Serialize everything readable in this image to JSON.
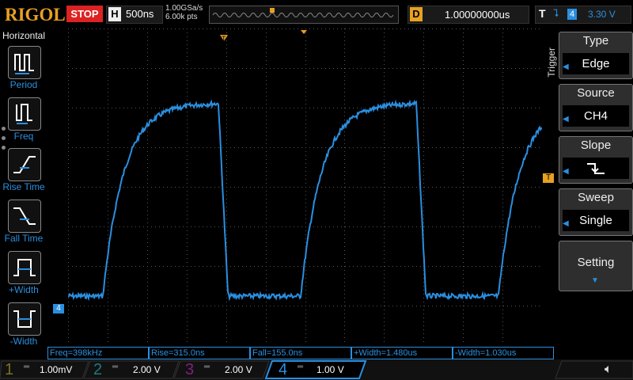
{
  "header": {
    "logo": "RIGOL",
    "run_state": "STOP",
    "horizontal_letter": "H",
    "timebase": "500ns",
    "sample_rate": "1.00GSa/s",
    "memory_depth": "6.00k pts",
    "delay_letter": "D",
    "delay": "1.00000000us",
    "trigger_letter": "T",
    "trigger_source": "4",
    "trigger_level": "3.30 V"
  },
  "left_panel": {
    "title": "Horizontal",
    "items": [
      {
        "label": "Period",
        "icon": "period-icon"
      },
      {
        "label": "Freq",
        "icon": "freq-icon"
      },
      {
        "label": "Rise Time",
        "icon": "rise-time-icon"
      },
      {
        "label": "Fall Time",
        "icon": "fall-time-icon"
      },
      {
        "label": "+Width",
        "icon": "positive-width-icon"
      },
      {
        "label": "-Width",
        "icon": "negative-width-icon"
      }
    ]
  },
  "right_panel": {
    "title": "Trigger",
    "buttons": [
      {
        "title": "Type",
        "value": "Edge"
      },
      {
        "title": "Source",
        "value": "CH4"
      },
      {
        "title": "Slope",
        "value": "falling-edge-icon"
      },
      {
        "title": "Sweep",
        "value": "Single"
      },
      {
        "title": "Setting",
        "value": ""
      }
    ]
  },
  "measurements": [
    "Freq=398kHz",
    "Rise=315.0ns",
    "Fall=155.0ns",
    "+Width=1.480us",
    "-Width=1.030us"
  ],
  "channels": [
    {
      "num": "1",
      "scale": "1.00mV",
      "color": "#e8d020",
      "active": false
    },
    {
      "num": "2",
      "scale": "2.00 V",
      "color": "#20c8d0",
      "active": false
    },
    {
      "num": "3",
      "scale": "2.00 V",
      "color": "#d030d0",
      "active": false
    },
    {
      "num": "4",
      "scale": "1.00 V",
      "color": "#2a8fe0",
      "active": true
    }
  ],
  "waveform": {
    "channel_label": "4",
    "trigger_marker": "T",
    "color": "#2a8fe0"
  }
}
